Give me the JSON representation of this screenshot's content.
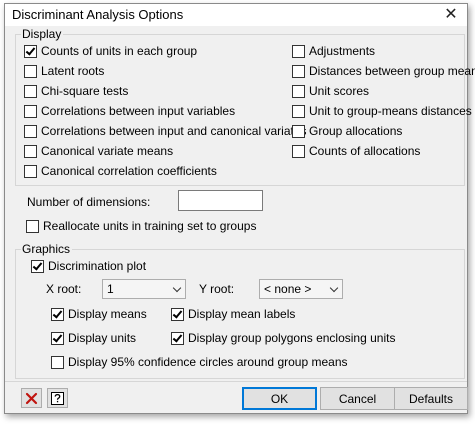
{
  "window": {
    "title": "Discriminant Analysis Options",
    "close_glyph": "✕"
  },
  "display": {
    "legend": "Display",
    "left_options": [
      {
        "label": "Counts of units in each group",
        "checked": true
      },
      {
        "label": "Latent roots",
        "checked": false
      },
      {
        "label": "Chi-square tests",
        "checked": false
      },
      {
        "label": "Correlations between input variables",
        "checked": false
      },
      {
        "label": "Correlations between input and canonical variates",
        "checked": false
      },
      {
        "label": "Canonical variate means",
        "checked": false
      },
      {
        "label": "Canonical correlation coefficients",
        "checked": false
      }
    ],
    "right_options": [
      {
        "label": "Adjustments",
        "checked": false
      },
      {
        "label": "Distances between group means",
        "checked": false
      },
      {
        "label": "Unit scores",
        "checked": false
      },
      {
        "label": "Unit to group-means distances",
        "checked": false
      },
      {
        "label": "Group allocations",
        "checked": false
      },
      {
        "label": "Counts of allocations",
        "checked": false
      }
    ]
  },
  "dimensions": {
    "label": "Number of dimensions:",
    "value": ""
  },
  "reallocate": {
    "label": "Reallocate units in training set to groups",
    "checked": false
  },
  "graphics": {
    "legend": "Graphics",
    "discrimination_plot": {
      "label": "Discrimination plot",
      "checked": true
    },
    "x_root": {
      "label": "X root:",
      "value": "1"
    },
    "y_root": {
      "label": "Y root:",
      "value": "< none >"
    },
    "display_means": {
      "label": "Display means",
      "checked": true
    },
    "display_mean_labels": {
      "label": "Display mean labels",
      "checked": true
    },
    "display_units": {
      "label": "Display units",
      "checked": true
    },
    "display_group_polygons": {
      "label": "Display group polygons enclosing units",
      "checked": true
    },
    "display_confidence": {
      "label": "Display 95% confidence circles around group means",
      "checked": false
    }
  },
  "footer": {
    "clear_icon": "red-x-icon",
    "help_icon": "question-mark-icon",
    "ok": "OK",
    "cancel": "Cancel",
    "defaults": "Defaults"
  }
}
